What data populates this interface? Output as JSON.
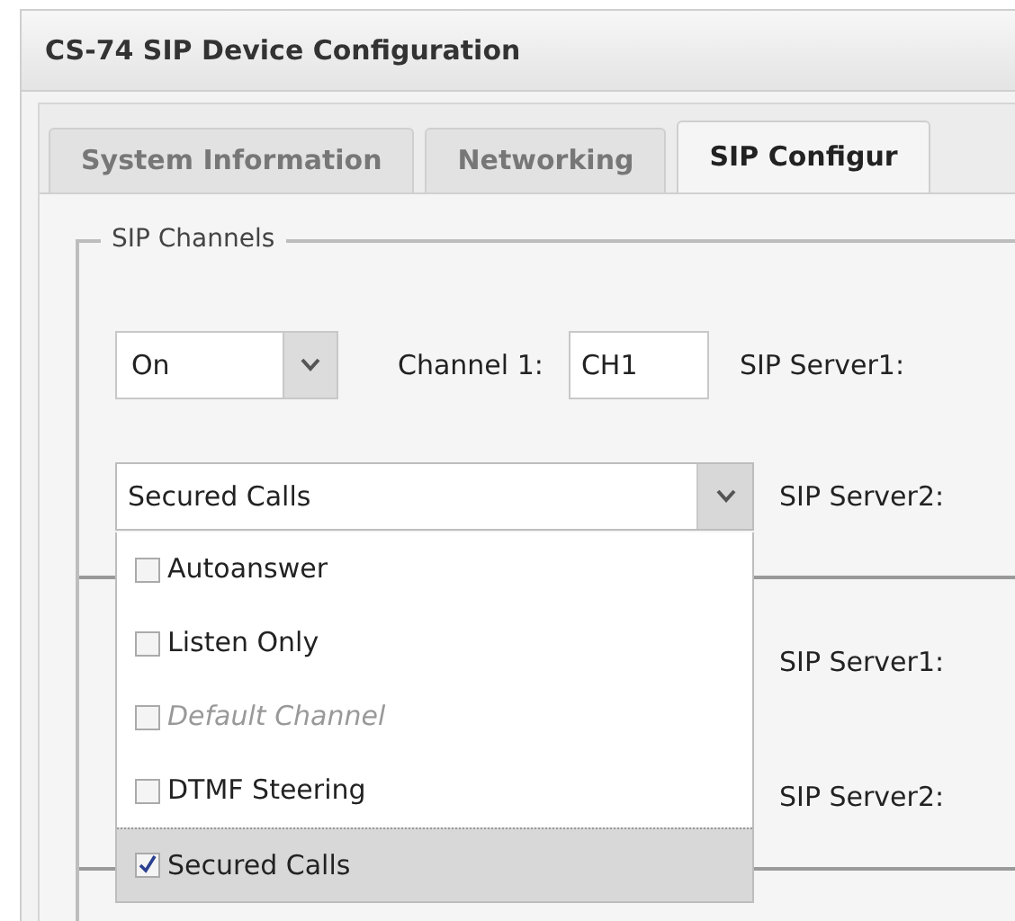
{
  "window": {
    "title": "CS-74 SIP Device Configuration"
  },
  "tabs": [
    {
      "label": "System Information",
      "selected": false
    },
    {
      "label": "Networking",
      "selected": false
    },
    {
      "label": "SIP Configur",
      "selected": true
    }
  ],
  "section": {
    "legend": "SIP Channels"
  },
  "channel": {
    "mode": "On",
    "label": "Channel 1:",
    "name": "CH1",
    "server1_label": "SIP Server1:",
    "options": "Secured Calls",
    "server2_label": "SIP Server2:"
  },
  "next_channel": {
    "server1_label": "SIP Server1:",
    "server2_label": "SIP Server2:"
  },
  "options_menu": {
    "expanded": true,
    "items": [
      {
        "label": "Autoanswer",
        "checked": false,
        "disabled": false,
        "highlighted": false
      },
      {
        "label": "Listen Only",
        "checked": false,
        "disabled": false,
        "highlighted": false
      },
      {
        "label": "Default Channel",
        "checked": false,
        "disabled": true,
        "highlighted": false
      },
      {
        "label": "DTMF Steering",
        "checked": false,
        "disabled": false,
        "highlighted": false
      },
      {
        "label": "Secured Calls",
        "checked": true,
        "disabled": false,
        "highlighted": true
      }
    ]
  }
}
